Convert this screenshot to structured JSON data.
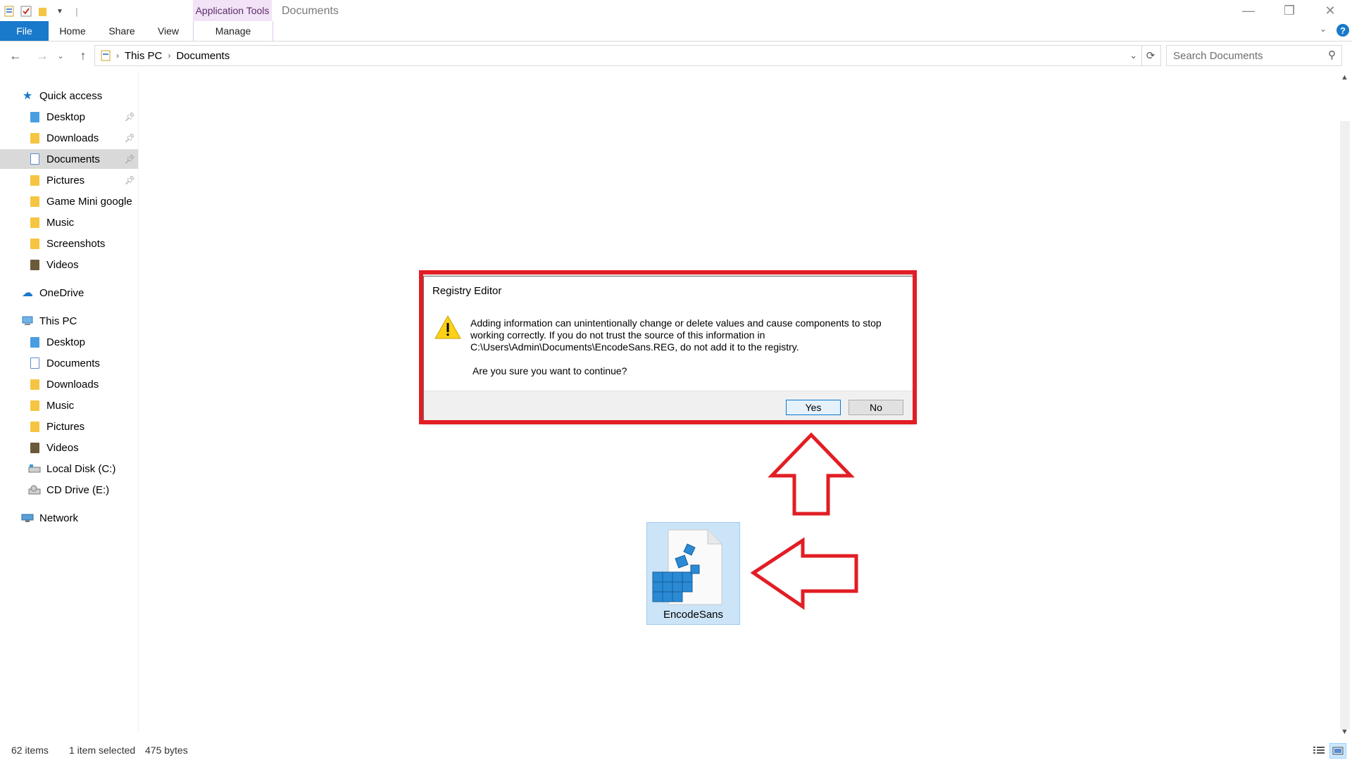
{
  "window": {
    "title": "Documents",
    "context_tab": "Application Tools",
    "minimize_icon": "minimize-icon",
    "maximize_icon": "restore-icon",
    "close_icon": "close-icon"
  },
  "ribbon": {
    "tabs": [
      "File",
      "Home",
      "Share",
      "View",
      "Manage"
    ],
    "help_label": "?"
  },
  "address": {
    "crumbs": [
      "This PC",
      "Documents"
    ],
    "search_placeholder": "Search Documents"
  },
  "sidebar": {
    "quick_access": "Quick access",
    "quick_items": [
      {
        "label": "Desktop",
        "icon": "desktop-folder-icon",
        "pinned": true
      },
      {
        "label": "Downloads",
        "icon": "downloads-folder-icon",
        "pinned": true
      },
      {
        "label": "Documents",
        "icon": "documents-folder-icon",
        "pinned": true,
        "selected": true
      },
      {
        "label": "Pictures",
        "icon": "pictures-folder-icon",
        "pinned": true
      },
      {
        "label": "Game Mini google",
        "icon": "folder-icon",
        "pinned": false
      },
      {
        "label": "Music",
        "icon": "music-folder-icon",
        "pinned": false
      },
      {
        "label": "Screenshots",
        "icon": "folder-icon",
        "pinned": false
      },
      {
        "label": "Videos",
        "icon": "videos-folder-icon",
        "pinned": false
      }
    ],
    "onedrive": "OneDrive",
    "this_pc": "This PC",
    "pc_items": [
      {
        "label": "Desktop",
        "icon": "desktop-folder-icon"
      },
      {
        "label": "Documents",
        "icon": "documents-folder-icon"
      },
      {
        "label": "Downloads",
        "icon": "downloads-folder-icon"
      },
      {
        "label": "Music",
        "icon": "music-folder-icon"
      },
      {
        "label": "Pictures",
        "icon": "pictures-folder-icon"
      },
      {
        "label": "Videos",
        "icon": "videos-folder-icon"
      },
      {
        "label": "Local Disk (C:)",
        "icon": "local-disk-icon"
      },
      {
        "label": "CD Drive (E:)",
        "icon": "cd-drive-icon"
      }
    ],
    "network": "Network"
  },
  "content": {
    "file_name": "EncodeSans"
  },
  "dialog": {
    "title": "Registry Editor",
    "message": "Adding information can unintentionally change or delete values and cause components to stop working correctly. If you do not trust the source of this information in C:\\Users\\Admin\\Documents\\EncodeSans.REG, do not add it to the registry.",
    "question": "Are you sure you want to continue?",
    "yes_label": "Yes",
    "no_label": "No"
  },
  "status": {
    "item_count": "62 items",
    "selection": "1 item selected",
    "size": "475 bytes"
  },
  "colors": {
    "accent": "#1979ca",
    "annotation_red": "#e21d24",
    "context_tab_bg": "#f3e3f7"
  }
}
